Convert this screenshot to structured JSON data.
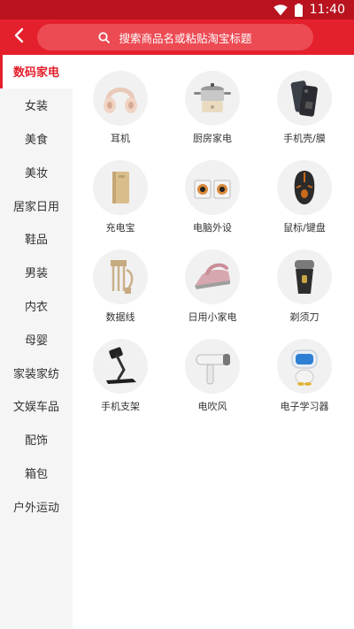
{
  "status_bar": {
    "time": "11:40",
    "icons": [
      "wifi-icon",
      "battery-icon"
    ]
  },
  "header": {
    "back_icon": "chevron-left-icon",
    "search": {
      "icon": "search-icon",
      "placeholder": "搜索商品名或粘贴淘宝标题"
    }
  },
  "colors": {
    "brand_red": "#e4202c",
    "status_bar_red": "#b8131f",
    "sidebar_bg": "#f5f5f5"
  },
  "sidebar": {
    "active_index": 0,
    "items": [
      {
        "label": "数码家电"
      },
      {
        "label": "女装"
      },
      {
        "label": "美食"
      },
      {
        "label": "美妆"
      },
      {
        "label": "居家日用"
      },
      {
        "label": "鞋品"
      },
      {
        "label": "男装"
      },
      {
        "label": "内衣"
      },
      {
        "label": "母婴"
      },
      {
        "label": "家装家纺"
      },
      {
        "label": "文娱车品"
      },
      {
        "label": "配饰"
      },
      {
        "label": "箱包"
      },
      {
        "label": "户外运动"
      }
    ]
  },
  "categories": [
    {
      "label": "耳机",
      "icon": "headphones-icon"
    },
    {
      "label": "厨房家电",
      "icon": "cooking-pot-icon"
    },
    {
      "label": "手机壳/膜",
      "icon": "phone-case-icon"
    },
    {
      "label": "充电宝",
      "icon": "power-bank-icon"
    },
    {
      "label": "电脑外设",
      "icon": "speakers-icon"
    },
    {
      "label": "鼠标/键盘",
      "icon": "gaming-mouse-icon"
    },
    {
      "label": "数据线",
      "icon": "cable-icon"
    },
    {
      "label": "日用小家电",
      "icon": "steam-iron-icon"
    },
    {
      "label": "剃须刀",
      "icon": "shaver-icon"
    },
    {
      "label": "手机支架",
      "icon": "phone-stand-icon"
    },
    {
      "label": "电吹风",
      "icon": "hair-dryer-icon"
    },
    {
      "label": "电子学习器",
      "icon": "learning-robot-icon"
    }
  ]
}
